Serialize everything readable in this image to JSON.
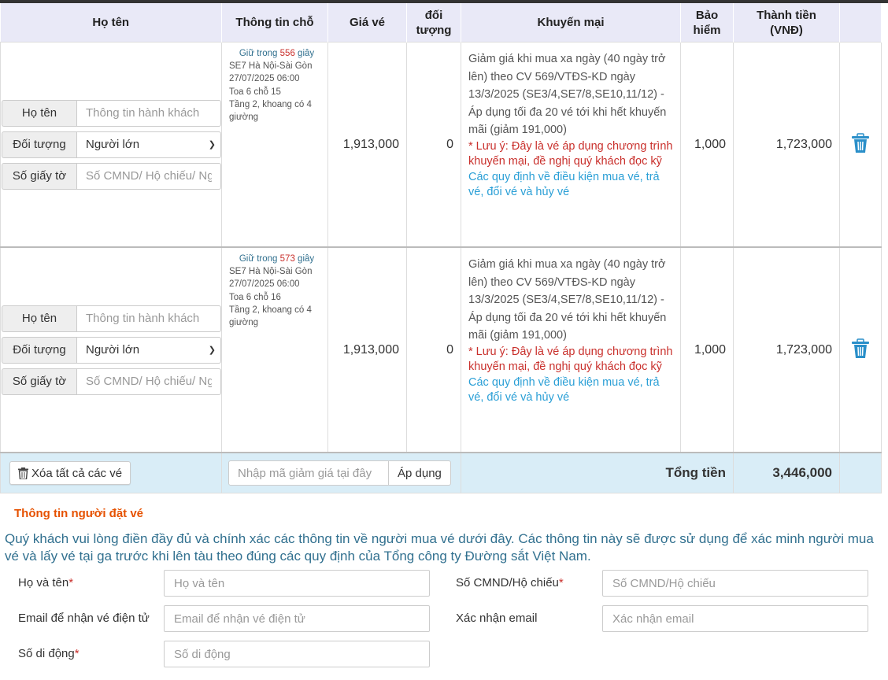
{
  "headers": {
    "name": "Họ tên",
    "seat": "Thông tin chỗ",
    "price": "Giá vé",
    "discount_obj": "đối\ntượng",
    "promo": "Khuyến mại",
    "insurance": "Bảo\nhiểm",
    "total": "Thành tiền\n(VNĐ)"
  },
  "labels": {
    "name": "Họ tên",
    "type": "Đối tượng",
    "id": "Số giấy tờ",
    "name_placeholder": "Thông tin hành khách",
    "id_placeholder": "Số CMND/ Hộ chiếu/ Ngày sinh trẻ em"
  },
  "passengers": [
    {
      "type_value": "Người lớn",
      "hold_prefix": "Giữ trong",
      "hold_seconds": "556",
      "hold_suffix": "giây",
      "train": "SE7 Hà Nội-Sài Gòn",
      "datetime": "27/07/2025 06:00",
      "car": "Toa 6 chỗ 15",
      "floor": "Tầng 2, khoang có 4 giường",
      "price": "1,913,000",
      "discount": "0",
      "promo_text": "Giảm giá khi mua xa ngày (40 ngày trở lên) theo CV 569/VTĐS-KD ngày 13/3/2025 (SE3/4,SE7/8,SE10,11/12) - Áp dụng tối đa 20 vé tới khi hết khuyến mãi (giảm 191,000)",
      "promo_warning": "* Lưu ý: Đây là vé áp dụng chương trình khuyến mại, đề nghị quý khách đọc kỹ",
      "promo_rules": "Các quy định về điều kiện mua vé, trả vé, đổi vé và hủy vé",
      "insurance": "1,000",
      "total": "1,723,000"
    },
    {
      "type_value": "Người lớn",
      "hold_prefix": "Giữ trong",
      "hold_seconds": "573",
      "hold_suffix": "giây",
      "train": "SE7 Hà Nội-Sài Gòn",
      "datetime": "27/07/2025 06:00",
      "car": "Toa 6 chỗ 16",
      "floor": "Tầng 2, khoang có 4 giường",
      "price": "1,913,000",
      "discount": "0",
      "promo_text": "Giảm giá khi mua xa ngày (40 ngày trở lên) theo CV 569/VTĐS-KD ngày 13/3/2025 (SE3/4,SE7/8,SE10,11/12) - Áp dụng tối đa 20 vé tới khi hết khuyến mãi (giảm 191,000)",
      "promo_warning": "* Lưu ý: Đây là vé áp dụng chương trình khuyến mại, đề nghị quý khách đọc kỹ",
      "promo_rules": "Các quy định về điều kiện mua vé, trả vé, đổi vé và hủy vé",
      "insurance": "1,000",
      "total": "1,723,000"
    }
  ],
  "footer": {
    "clear_all": "Xóa tất cả các vé",
    "discount_placeholder": "Nhập mã giảm giá tại đây",
    "apply": "Áp dụng",
    "total_label": "Tổng tiền",
    "total_value": "3,446,000"
  },
  "booker": {
    "title": "Thông tin người đặt vé",
    "intro": "Quý khách vui lòng điền đầy đủ và chính xác các thông tin về người mua vé dưới đây. Các thông tin này sẽ được sử dụng để xác minh người mua vé và lấy vé tại ga trước khi lên tàu theo đúng các quy định của Tổng công ty Đường sắt Việt Nam.",
    "name_label": "Họ và tên",
    "name_placeholder": "Họ và tên",
    "id_label": "Số CMND/Hộ chiếu",
    "id_placeholder": "Số CMND/Hộ chiếu",
    "email_label": "Email để nhận vé điện tử",
    "email_placeholder": "Email để nhận vé điện tử",
    "confirm_email_label": "Xác nhận email",
    "confirm_email_placeholder": "Xác nhận email",
    "phone_label": "Số di động",
    "phone_placeholder": "Số di động",
    "required_mark": "*"
  },
  "colors": {
    "header_bg": "#e9e9f7",
    "footer_bg": "#d9edf7",
    "accent_orange": "#e65100",
    "info_blue": "#31708f",
    "warn_red": "#c9302c",
    "link_blue": "#2a9fd6"
  },
  "icons": {
    "delete": "trash-icon",
    "clear_all": "trash-icon"
  }
}
